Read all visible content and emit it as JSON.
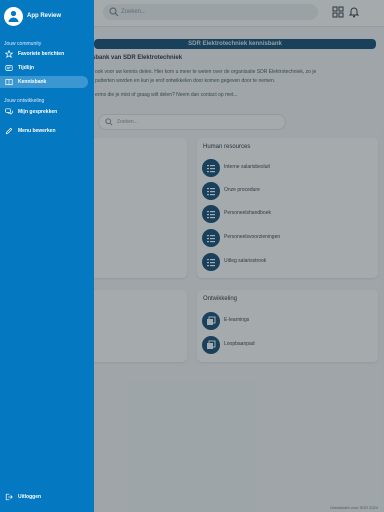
{
  "page": {
    "search_placeholder": "Zoeken...",
    "banner": "SDR Elektrotechniek kennisbank",
    "intro_title": "sbank van SDR Elektrotechniek",
    "intro_lines": [
      "ook voor uw kennis delen. Hier kom u meer te weten over de organisatie SDR Elektrotechniek, zo je",
      "putterten worden en kun je erof ontwikkelen door komen gegeven door te nemen.",
      "erms die je mist of graag wilt delen? Neem dan contact op met..."
    ],
    "content_search_placeholder": "Zoeken...",
    "hr_card": {
      "title": "Human resources",
      "items": [
        "Interne salarisbesluit",
        "Onze procedure",
        "Personeelshandboek",
        "Personeelsvoorzieningen",
        "Uitleg salarisstrook"
      ]
    },
    "dev_card": {
      "title": "Ontwikkeling",
      "items": [
        "E-learnings",
        "Loopbaanpad"
      ]
    },
    "footer_text": "Ontwikkeld voor SDR 2024"
  },
  "drawer": {
    "app_name": "App Review",
    "section_community": "Jouw community",
    "community_items": [
      {
        "label": "Favoriete berichten",
        "icon": "star-icon"
      },
      {
        "label": "Tijdlijn",
        "icon": "timeline-icon"
      },
      {
        "label": "Kennisbank",
        "icon": "book-icon",
        "active": true
      }
    ],
    "section_development": "Jouw ontwikkeling",
    "development_items": [
      {
        "label": "Mijn gesprekken",
        "icon": "chat-icon"
      }
    ],
    "edit_menu": {
      "label": "Menu bewerken",
      "icon": "pencil-icon"
    },
    "logout": {
      "label": "Uitloggen",
      "icon": "logout-icon"
    }
  },
  "colors": {
    "drawer_bg": "#0478c0",
    "active_item_bg": "#3a97d1",
    "brand_dark": "#0e4a73"
  }
}
